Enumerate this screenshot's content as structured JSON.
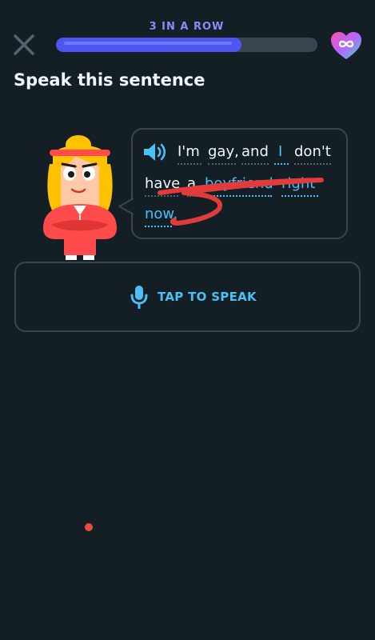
{
  "header": {
    "streak_label": "3 IN A ROW",
    "progress_fraction": 0.71,
    "close_icon": "close-icon",
    "hearts_icon": "infinity-heart-icon"
  },
  "exercise": {
    "title": "Speak this sentence",
    "speaker_icon": "speaker-icon",
    "sentence_words": [
      "I'm",
      "gay,",
      "and",
      "I",
      "don't",
      "have",
      "a",
      "boyfriend",
      "right",
      "now."
    ],
    "speak_button_label": "TAP TO SPEAK",
    "mic_icon": "microphone-icon"
  },
  "colors": {
    "background": "#131f24",
    "accent_blue": "#49c0f8",
    "progress": "#4b57f0",
    "streak_text": "#8a8cf8",
    "scribble_red": "#e23b3b"
  }
}
